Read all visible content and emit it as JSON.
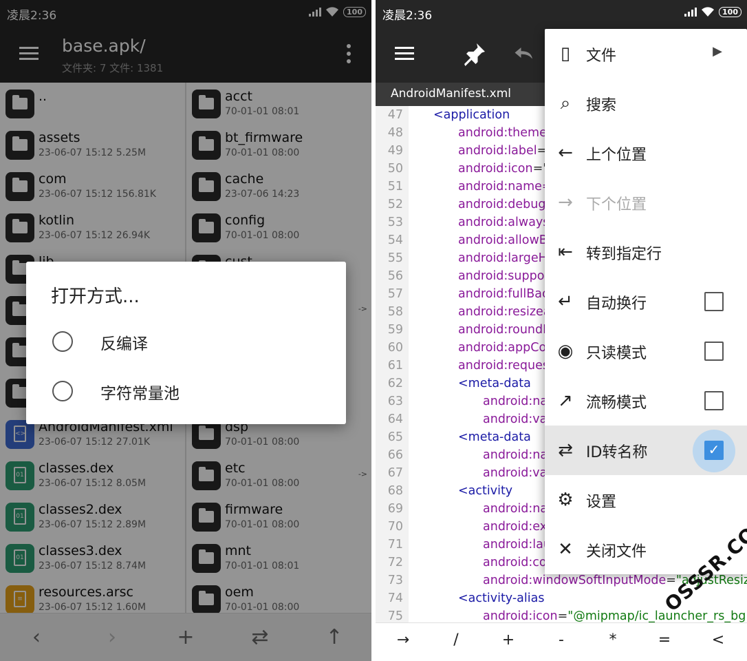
{
  "left": {
    "status": {
      "time": "凌晨2:36",
      "battery": "100"
    },
    "toolbar": {
      "title": "base.apk/",
      "subtitle": "文件夹: 7  文件: 1381"
    },
    "files_left": [
      {
        "name": "..",
        "meta": "",
        "kind": "folder"
      },
      {
        "name": "assets",
        "meta": "23-06-07 15:12  5.25M",
        "kind": "folder"
      },
      {
        "name": "com",
        "meta": "23-06-07 15:12  156.81K",
        "kind": "folder"
      },
      {
        "name": "kotlin",
        "meta": "23-06-07 15:12  26.94K",
        "kind": "folder"
      },
      {
        "name": "lib",
        "meta": "",
        "kind": "folder"
      },
      {
        "name": "",
        "meta": "",
        "kind": "folder"
      },
      {
        "name": "",
        "meta": "",
        "kind": "folder"
      },
      {
        "name": "",
        "meta": "",
        "kind": "folder"
      },
      {
        "name": "AndroidManifest.xml",
        "meta": "23-06-07 15:12  27.01K",
        "kind": "xml"
      },
      {
        "name": "classes.dex",
        "meta": "23-06-07 15:12  8.05M",
        "kind": "dex"
      },
      {
        "name": "classes2.dex",
        "meta": "23-06-07 15:12  2.89M",
        "kind": "dex"
      },
      {
        "name": "classes3.dex",
        "meta": "23-06-07 15:12  8.74M",
        "kind": "dex"
      },
      {
        "name": "resources.arsc",
        "meta": "23-06-07 15:12  1.60M",
        "kind": "arsc"
      }
    ],
    "files_right": [
      {
        "name": "acct",
        "meta": "70-01-01 08:01",
        "arrow": ""
      },
      {
        "name": "bt_firmware",
        "meta": "70-01-01 08:00",
        "arrow": ""
      },
      {
        "name": "cache",
        "meta": "23-07-06 14:23",
        "arrow": ""
      },
      {
        "name": "config",
        "meta": "70-01-01 08:00",
        "arrow": ""
      },
      {
        "name": "cust",
        "meta": "",
        "arrow": ""
      },
      {
        "name": "",
        "meta": "",
        "arrow": "->"
      },
      {
        "name": "",
        "meta": "",
        "arrow": ""
      },
      {
        "name": "",
        "meta": "",
        "arrow": ""
      },
      {
        "name": "dsp",
        "meta": "70-01-01 08:00",
        "arrow": ""
      },
      {
        "name": "etc",
        "meta": "70-01-01 08:00",
        "arrow": "->"
      },
      {
        "name": "firmware",
        "meta": "70-01-01 08:00",
        "arrow": ""
      },
      {
        "name": "mnt",
        "meta": "70-01-01 08:01",
        "arrow": ""
      },
      {
        "name": "oem",
        "meta": "70-01-01 08:00",
        "arrow": ""
      }
    ],
    "dialog": {
      "title": "打开方式...",
      "options": [
        "反编译",
        "字符常量池"
      ]
    },
    "bottom": {
      "back": "‹",
      "forward": "›",
      "add": "+",
      "swap": "⇄",
      "up": "↑"
    }
  },
  "right": {
    "status": {
      "time": "凌晨2:36",
      "battery": "100"
    },
    "tab": "AndroidManifest.xml",
    "code": [
      {
        "ln": "47",
        "indent": 0,
        "parts": [
          [
            "tag",
            "<application"
          ]
        ]
      },
      {
        "ln": "48",
        "indent": 1,
        "parts": [
          [
            "attr",
            "android:theme"
          ]
        ]
      },
      {
        "ln": "49",
        "indent": 1,
        "parts": [
          [
            "attr",
            "android:label"
          ],
          [
            "eq",
            "=\""
          ]
        ]
      },
      {
        "ln": "50",
        "indent": 1,
        "parts": [
          [
            "attr",
            "android:icon"
          ],
          [
            "eq",
            "=\"("
          ]
        ]
      },
      {
        "ln": "51",
        "indent": 1,
        "parts": [
          [
            "attr",
            "android:name="
          ]
        ]
      },
      {
        "ln": "52",
        "indent": 1,
        "parts": [
          [
            "attr",
            "android:debug"
          ]
        ]
      },
      {
        "ln": "53",
        "indent": 1,
        "parts": [
          [
            "attr",
            "android:always"
          ]
        ]
      },
      {
        "ln": "54",
        "indent": 1,
        "parts": [
          [
            "attr",
            "android:allowB"
          ]
        ]
      },
      {
        "ln": "55",
        "indent": 1,
        "parts": [
          [
            "attr",
            "android:largeH"
          ]
        ]
      },
      {
        "ln": "56",
        "indent": 1,
        "parts": [
          [
            "attr",
            "android:suppor"
          ]
        ]
      },
      {
        "ln": "57",
        "indent": 1,
        "parts": [
          [
            "attr",
            "android:fullBac"
          ]
        ]
      },
      {
        "ln": "58",
        "indent": 1,
        "parts": [
          [
            "attr",
            "android:resizea"
          ]
        ]
      },
      {
        "ln": "59",
        "indent": 1,
        "parts": [
          [
            "attr",
            "android:roundI"
          ]
        ]
      },
      {
        "ln": "60",
        "indent": 1,
        "parts": [
          [
            "attr",
            "android:appCo"
          ]
        ]
      },
      {
        "ln": "61",
        "indent": 1,
        "parts": [
          [
            "attr",
            "android:reques"
          ]
        ]
      },
      {
        "ln": "62",
        "indent": 1,
        "parts": [
          [
            "tag",
            "<meta-data"
          ]
        ]
      },
      {
        "ln": "63",
        "indent": 2,
        "parts": [
          [
            "attr",
            "android:na"
          ]
        ]
      },
      {
        "ln": "64",
        "indent": 2,
        "parts": [
          [
            "attr",
            "android:va"
          ]
        ]
      },
      {
        "ln": "65",
        "indent": 1,
        "parts": [
          [
            "tag",
            "<meta-data"
          ]
        ]
      },
      {
        "ln": "66",
        "indent": 2,
        "parts": [
          [
            "attr",
            "android:na"
          ]
        ]
      },
      {
        "ln": "67",
        "indent": 2,
        "parts": [
          [
            "attr",
            "android:va"
          ]
        ]
      },
      {
        "ln": "68",
        "indent": 1,
        "parts": [
          [
            "tag",
            "<activity"
          ]
        ]
      },
      {
        "ln": "69",
        "indent": 2,
        "parts": [
          [
            "attr",
            "android:na"
          ]
        ]
      },
      {
        "ln": "70",
        "indent": 2,
        "parts": [
          [
            "attr",
            "android:ex"
          ]
        ]
      },
      {
        "ln": "71",
        "indent": 2,
        "parts": [
          [
            "attr",
            "android:lau"
          ]
        ]
      },
      {
        "ln": "72",
        "indent": 2,
        "parts": [
          [
            "attr",
            "android:co"
          ]
        ]
      },
      {
        "ln": "73",
        "indent": 2,
        "parts": [
          [
            "attr",
            "android:windowSoftInputMode"
          ],
          [
            "eq",
            "="
          ],
          [
            "val",
            "\"adjustResiz"
          ]
        ]
      },
      {
        "ln": "74",
        "indent": 1,
        "parts": [
          [
            "tag",
            "<activity-alias"
          ]
        ]
      },
      {
        "ln": "75",
        "indent": 2,
        "parts": [
          [
            "attr",
            "android:icon"
          ],
          [
            "eq",
            "="
          ],
          [
            "val",
            "\"@mipmap/ic_launcher_rs_bg\""
          ]
        ]
      }
    ],
    "keys": [
      "→",
      "/",
      "+",
      "-",
      "*",
      "=",
      "<"
    ],
    "menu": [
      {
        "label": "文件",
        "icon": "file-icon",
        "glyph": "▯",
        "chevron": "▶"
      },
      {
        "label": "搜索",
        "icon": "search-icon",
        "glyph": "⌕"
      },
      {
        "label": "上个位置",
        "icon": "arrow-left-icon",
        "glyph": "←"
      },
      {
        "label": "下个位置",
        "icon": "arrow-right-icon",
        "glyph": "→",
        "disabled": true
      },
      {
        "label": "转到指定行",
        "icon": "goto-line-icon",
        "glyph": "⇤"
      },
      {
        "label": "自动换行",
        "icon": "wrap-icon",
        "glyph": "↵",
        "checkbox": "off"
      },
      {
        "label": "只读模式",
        "icon": "eye-icon",
        "glyph": "◉",
        "checkbox": "off"
      },
      {
        "label": "流畅模式",
        "icon": "trending-icon",
        "glyph": "↗",
        "checkbox": "off"
      },
      {
        "label": "ID转名称",
        "icon": "compare-arrows-icon",
        "glyph": "⇄",
        "checkbox": "on",
        "highlight": true
      },
      {
        "label": "设置",
        "icon": "gear-icon",
        "glyph": "⚙"
      },
      {
        "label": "关闭文件",
        "icon": "close-icon",
        "glyph": "✕"
      }
    ]
  },
  "watermark": "OSSSR.COM"
}
